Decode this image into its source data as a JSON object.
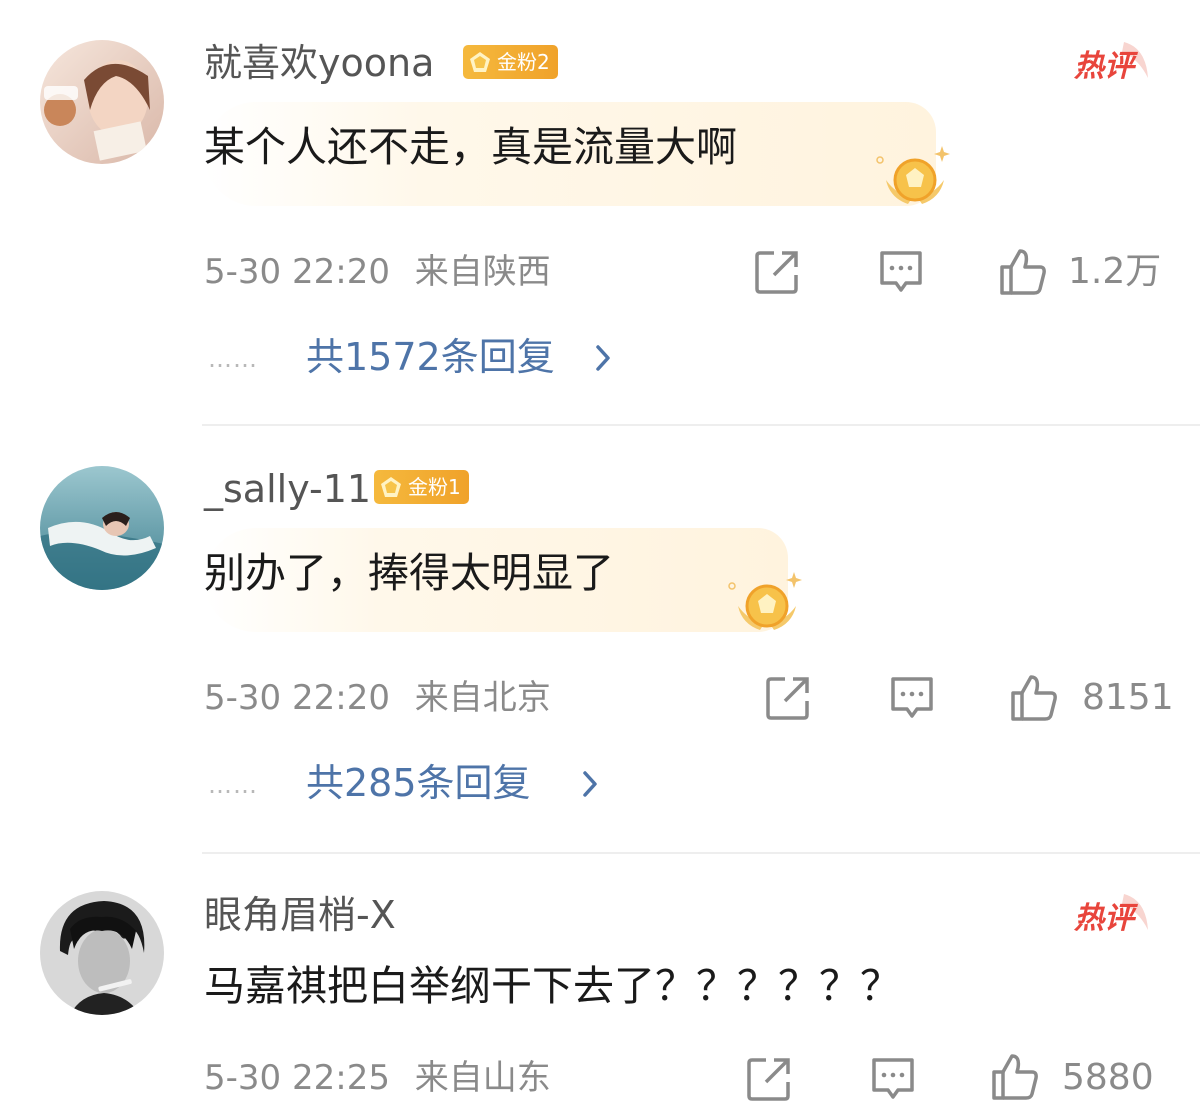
{
  "comments": [
    {
      "username": "就喜欢yoona",
      "badge": "金粉2",
      "hot_label": "热评",
      "text": "某个人还不走，真是流量大啊",
      "time": "5-30 22:20",
      "location": "来自陕西",
      "likes": "1.2万",
      "replies": "共1572条回复",
      "avatar_tint": "#e8cfc6"
    },
    {
      "username": "_sally-11",
      "badge": "金粉1",
      "text": "别办了，捧得太明显了",
      "time": "5-30 22:20",
      "location": "来自北京",
      "likes": "8151",
      "replies": "共285条回复",
      "avatar_tint": "#6fa2b0"
    },
    {
      "username": "眼角眉梢-X",
      "hot_label": "热评",
      "text": "马嘉祺把白举纲干下去了？？？？？？",
      "time": "5-30 22:25",
      "location": "来自山东",
      "likes": "5880",
      "avatar_tint": "#3a3a3a"
    }
  ],
  "reply_dots": "……",
  "colors": {
    "link": "#4e74a8",
    "hot": "#e8453c",
    "badge": "#f3ad31",
    "meta": "#8a8a8a"
  },
  "icons": [
    "share-icon",
    "comment-icon",
    "like-icon",
    "chevron-right-icon",
    "hot-comment-icon",
    "gold-fan-medal-icon"
  ]
}
